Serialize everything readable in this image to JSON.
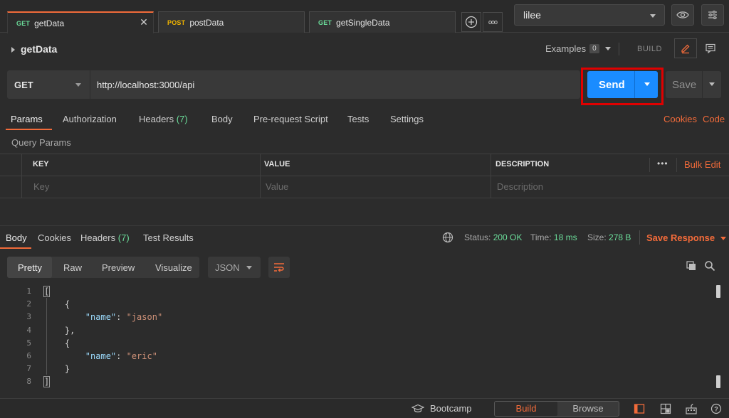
{
  "tabs": [
    {
      "method": "GET",
      "name": "getData"
    },
    {
      "method": "POST",
      "name": "postData"
    },
    {
      "method": "GET",
      "name": "getSingleData"
    }
  ],
  "tab_close_glyph": "✕",
  "more_glyph": "ooo",
  "environment": {
    "selected": "lilee"
  },
  "request": {
    "title": "getData",
    "examples_label": "Examples",
    "examples_count": "0",
    "build_label": "BUILD",
    "method": "GET",
    "url": "http://localhost:3000/api",
    "send_label": "Send",
    "save_label": "Save"
  },
  "request_tabs": {
    "params": "Params",
    "authorization": "Authorization",
    "headers": "Headers",
    "headers_count": "(7)",
    "body": "Body",
    "prerequest": "Pre-request Script",
    "tests": "Tests",
    "settings": "Settings",
    "cookies": "Cookies",
    "code": "Code"
  },
  "query_params": {
    "label": "Query Params",
    "columns": [
      "KEY",
      "VALUE",
      "DESCRIPTION"
    ],
    "placeholders": [
      "Key",
      "Value",
      "Description"
    ],
    "more_glyph": "•••",
    "bulk_edit": "Bulk Edit"
  },
  "response": {
    "tabs": {
      "body": "Body",
      "cookies": "Cookies",
      "headers": "Headers",
      "headers_count": "(7)",
      "test_results": "Test Results"
    },
    "status_label": "Status:",
    "status_value": "200 OK",
    "time_label": "Time:",
    "time_value": "18 ms",
    "size_label": "Size:",
    "size_value": "278 B",
    "save_response": "Save Response",
    "views": [
      "Pretty",
      "Raw",
      "Preview",
      "Visualize"
    ],
    "format": "JSON",
    "code_lines": [
      {
        "n": "1",
        "parts": [
          [
            "p",
            "["
          ]
        ]
      },
      {
        "n": "2",
        "parts": [
          [
            "p",
            "    {"
          ]
        ]
      },
      {
        "n": "3",
        "parts": [
          [
            "p",
            "        "
          ],
          [
            "k",
            "\"name\""
          ],
          [
            "p",
            ": "
          ],
          [
            "s",
            "\"jason\""
          ]
        ]
      },
      {
        "n": "4",
        "parts": [
          [
            "p",
            "    },"
          ]
        ]
      },
      {
        "n": "5",
        "parts": [
          [
            "p",
            "    {"
          ]
        ]
      },
      {
        "n": "6",
        "parts": [
          [
            "p",
            "        "
          ],
          [
            "k",
            "\"name\""
          ],
          [
            "p",
            ": "
          ],
          [
            "s",
            "\"eric\""
          ]
        ]
      },
      {
        "n": "7",
        "parts": [
          [
            "p",
            "    }"
          ]
        ]
      },
      {
        "n": "8",
        "parts": [
          [
            "p",
            "]"
          ]
        ]
      }
    ]
  },
  "statusbar": {
    "bootcamp": "Bootcamp",
    "build": "Build",
    "browse": "Browse",
    "help_glyph": "?"
  },
  "colors": {
    "accent": "#f26b3a",
    "send": "#1a8cff",
    "ok": "#6bdd9a",
    "highlight": "#e00000"
  }
}
